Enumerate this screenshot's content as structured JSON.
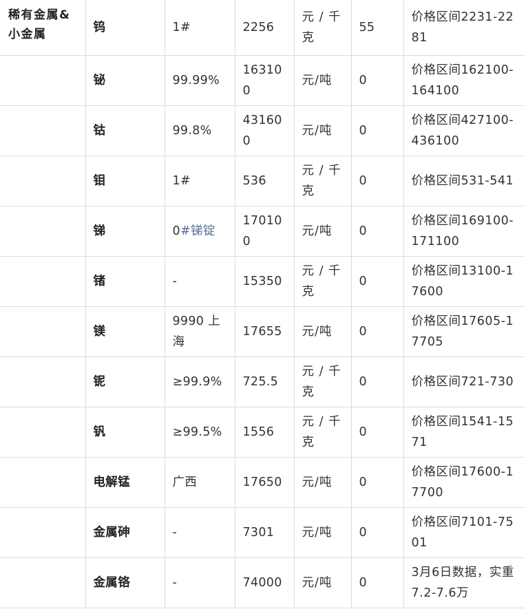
{
  "category": "稀有金属& 小金属",
  "rows": [
    {
      "name": "钨",
      "spec": "1#",
      "price": "2256",
      "unit": "元 / 千克",
      "change": "55",
      "range": "价格区间2231-2281"
    },
    {
      "name": "铋",
      "spec": "99.99%",
      "price": "163100",
      "unit": "元/吨",
      "change": "0",
      "range": "价格区间162100-164100"
    },
    {
      "name": "钴",
      "spec": "99.8%",
      "price": "431600",
      "unit": "元/吨",
      "change": "0",
      "range": "价格区间427100-436100"
    },
    {
      "name": "钼",
      "spec": "1#",
      "price": "536",
      "unit": "元 / 千克",
      "change": "0",
      "range": "价格区间531-541"
    },
    {
      "name": "锑",
      "spec_prefix": "0",
      "spec_link": "#锑锭",
      "price": "170100",
      "unit": "元/吨",
      "change": "0",
      "range": "价格区间169100-171100"
    },
    {
      "name": "锗",
      "spec": "-",
      "price": "15350",
      "unit": "元 / 千克",
      "change": "0",
      "range": "价格区间13100-17600"
    },
    {
      "name": "镁",
      "spec": "9990 上海",
      "price": "17655",
      "unit": "元/吨",
      "change": "0",
      "range": "价格区间17605-17705"
    },
    {
      "name": "铌",
      "spec": "≥99.9%",
      "price": "725.5",
      "unit": "元 / 千克",
      "change": "0",
      "range": "价格区间721-730"
    },
    {
      "name": "钒",
      "spec": "≥99.5%",
      "price": "1556",
      "unit": "元 / 千克",
      "change": "0",
      "range": "价格区间1541-1571"
    },
    {
      "name": "电解锰",
      "spec": "广西",
      "price": "17650",
      "unit": "元/吨",
      "change": "0",
      "range": "价格区间17600-17700"
    },
    {
      "name": "金属砷",
      "spec": "-",
      "price": "7301",
      "unit": "元/吨",
      "change": "0",
      "range": "价格区间7101-7501"
    },
    {
      "name": "金属铬",
      "spec": "-",
      "price": "74000",
      "unit": "元/吨",
      "change": "0",
      "range": "3月6日数据，实重7.2-7.6万"
    }
  ]
}
